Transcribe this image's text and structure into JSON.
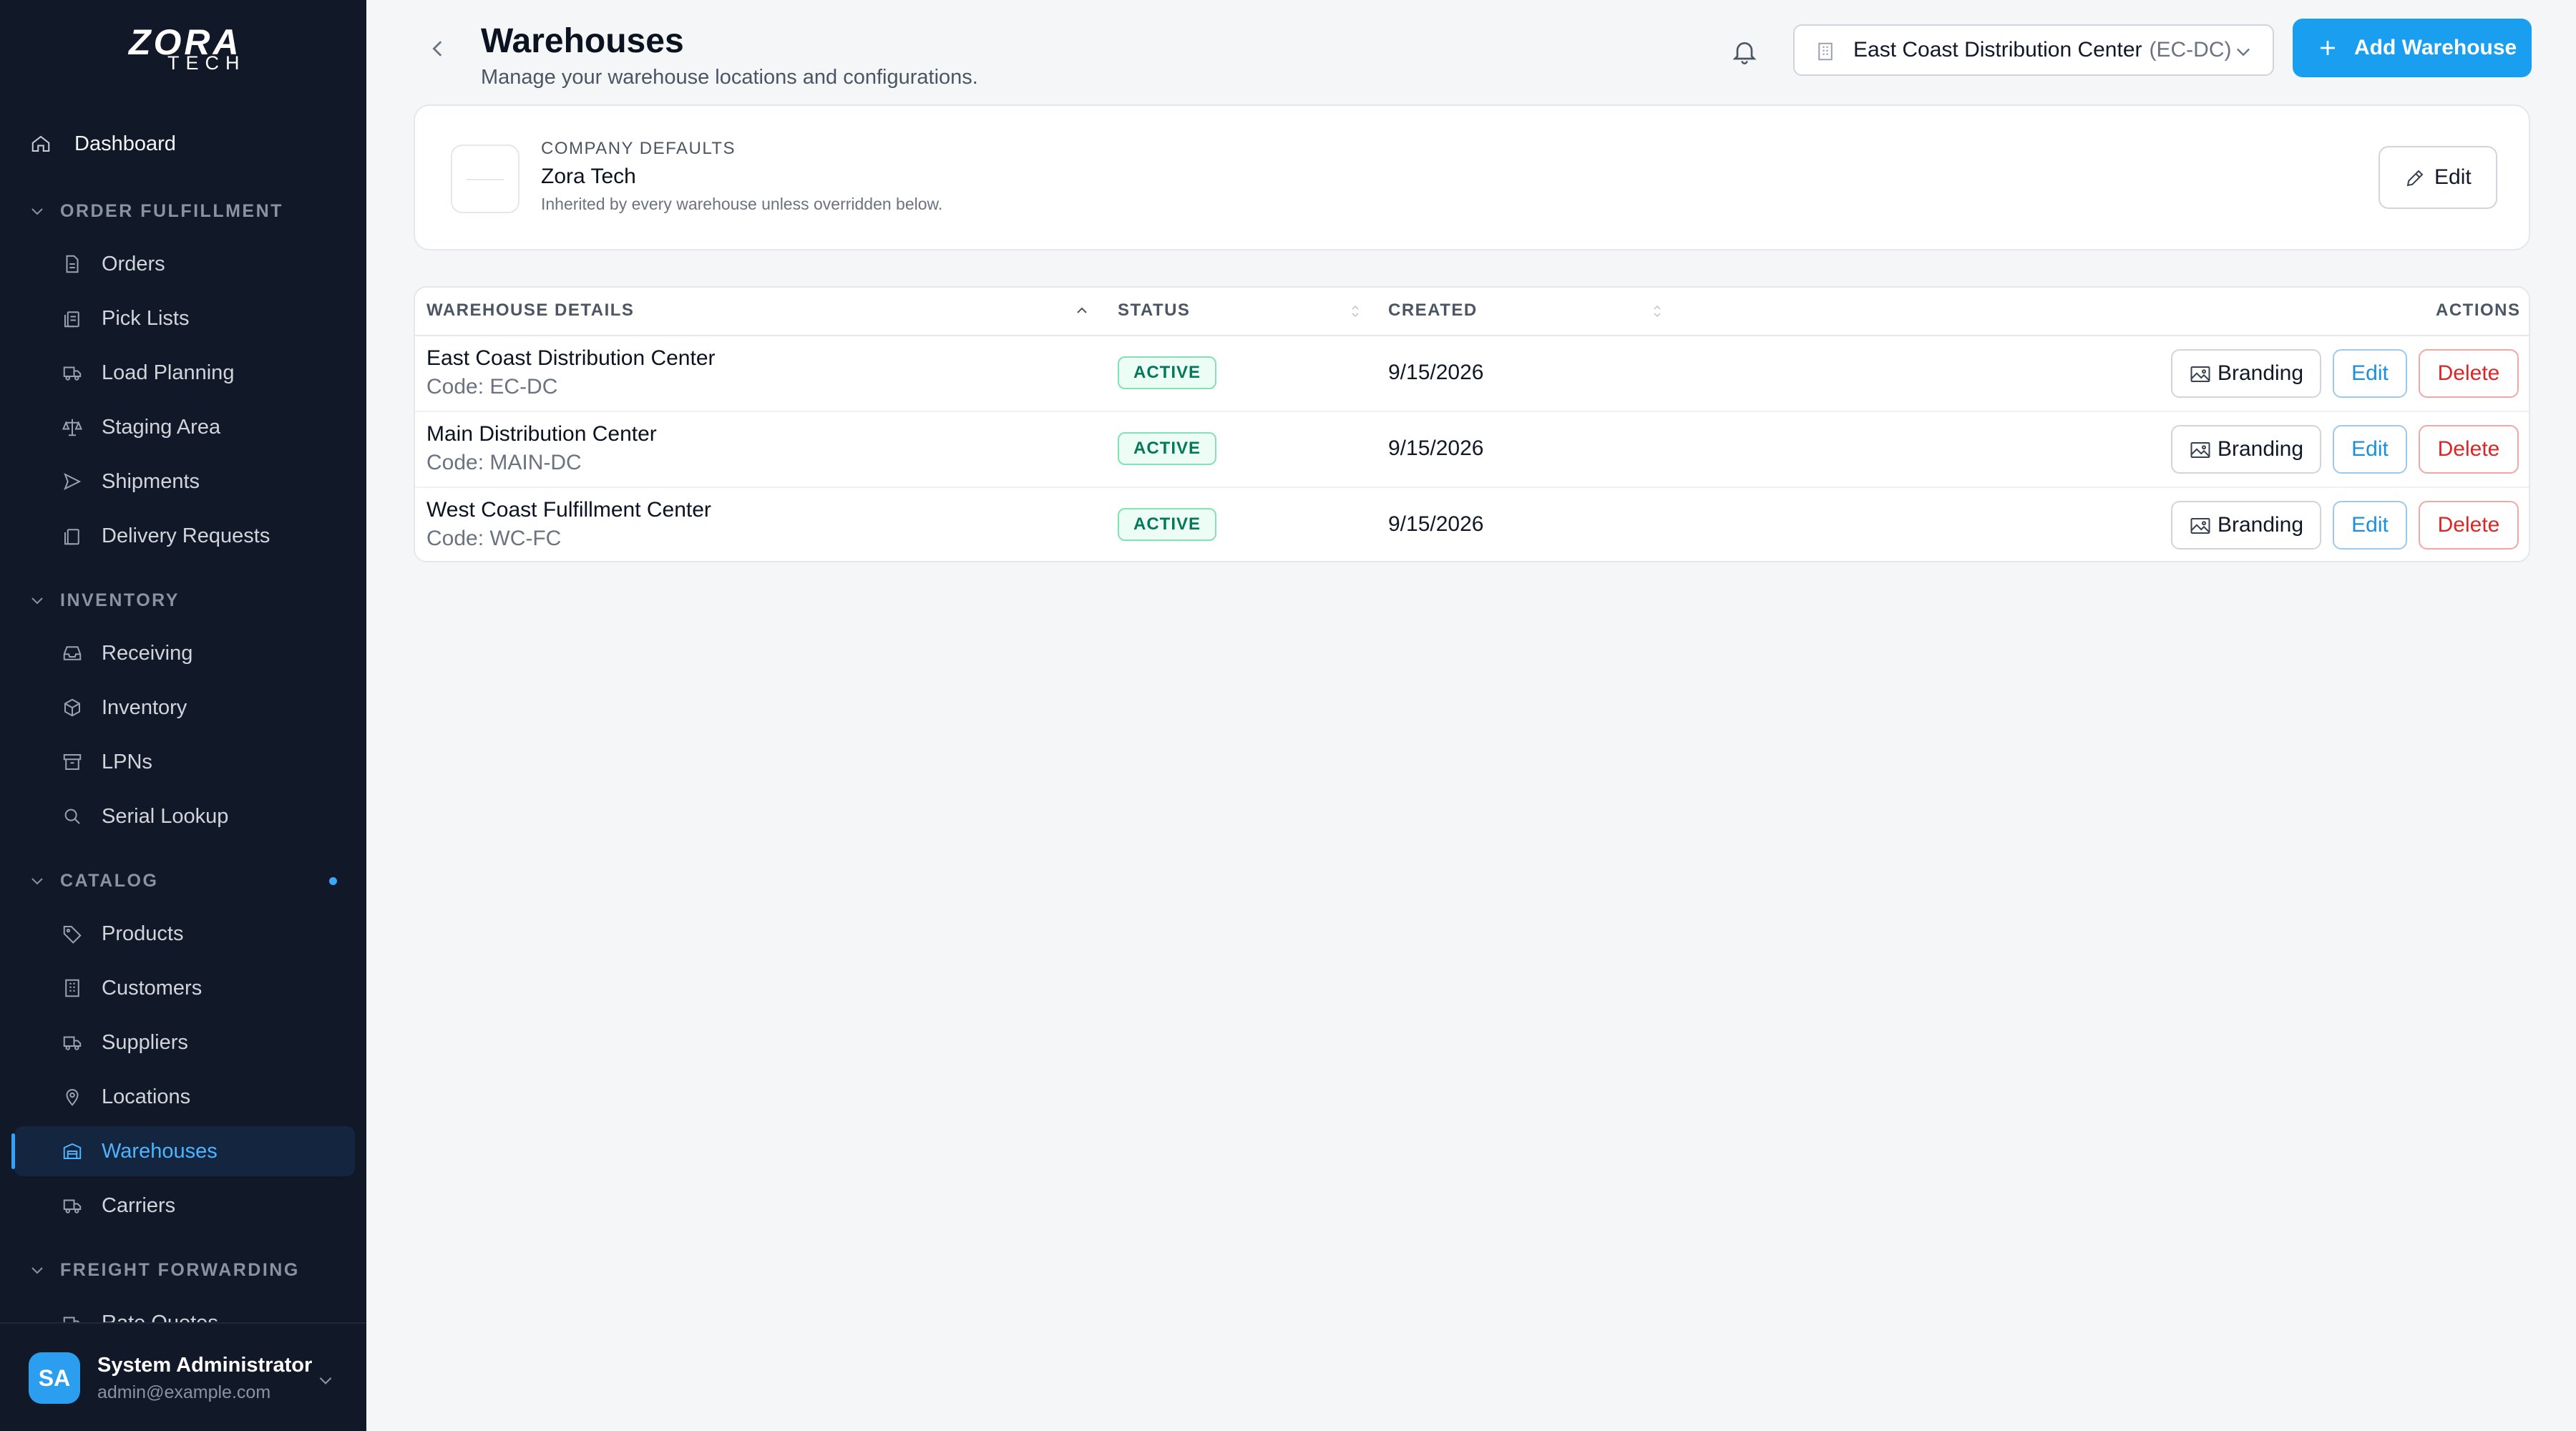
{
  "brand": {
    "line1": "ZORA",
    "line2": "TECH"
  },
  "sidebar": {
    "dashboard": "Dashboard",
    "sections": [
      {
        "title": "ORDER FULFILLMENT",
        "items": [
          "Orders",
          "Pick Lists",
          "Load Planning",
          "Staging Area",
          "Shipments",
          "Delivery Requests"
        ]
      },
      {
        "title": "INVENTORY",
        "items": [
          "Receiving",
          "Inventory",
          "LPNs",
          "Serial Lookup"
        ]
      },
      {
        "title": "CATALOG",
        "items": [
          "Products",
          "Customers",
          "Suppliers",
          "Locations",
          "Warehouses",
          "Carriers"
        ]
      },
      {
        "title": "FREIGHT FORWARDING",
        "items": [
          "Rate Quotes"
        ]
      }
    ],
    "active_item": "Warehouses"
  },
  "user": {
    "initials": "SA",
    "name": "System Administrator",
    "email": "admin@example.com"
  },
  "header": {
    "title": "Warehouses",
    "subtitle": "Manage your warehouse locations and configurations.",
    "warehouse_selector": {
      "name": "East Coast Distribution Center",
      "code": "(EC-DC)"
    },
    "add_button": "Add Warehouse"
  },
  "company_defaults": {
    "label": "COMPANY DEFAULTS",
    "name": "Zora Tech",
    "note": "Inherited by every warehouse unless overridden below.",
    "edit_label": "Edit"
  },
  "table": {
    "columns": [
      "WAREHOUSE DETAILS",
      "STATUS",
      "CREATED",
      "ACTIONS"
    ],
    "rows": [
      {
        "name": "East Coast Distribution Center",
        "code": "Code: EC-DC",
        "status": "ACTIVE",
        "created": "9/15/2026"
      },
      {
        "name": "Main Distribution Center",
        "code": "Code: MAIN-DC",
        "status": "ACTIVE",
        "created": "9/15/2026"
      },
      {
        "name": "West Coast Fulfillment Center",
        "code": "Code: WC-FC",
        "status": "ACTIVE",
        "created": "9/15/2026"
      }
    ],
    "actions": {
      "branding": "Branding",
      "edit": "Edit",
      "delete": "Delete"
    }
  },
  "colors": {
    "sidebar_bg": "#111827",
    "accent": "#1a9ff0",
    "active_text": "#4fb4ff",
    "success": "#047857",
    "danger": "#dc2626"
  }
}
